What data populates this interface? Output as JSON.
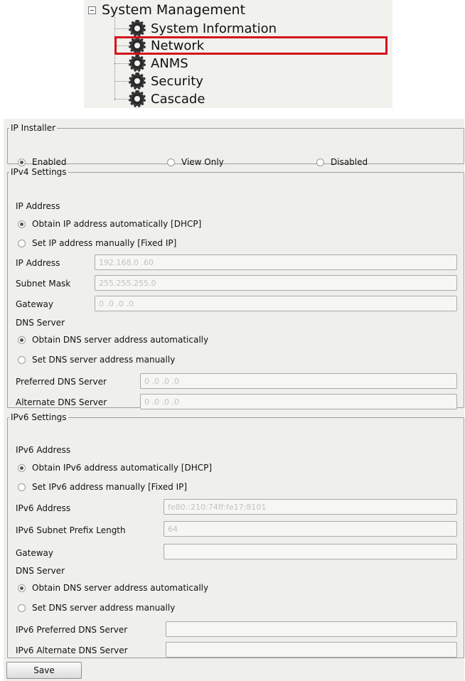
{
  "tree": {
    "root_label": "System Management",
    "items": [
      "System Information",
      "Network",
      "ANMS",
      "Security",
      "Cascade"
    ],
    "selected": "Network",
    "highlight_color": "#d3131b"
  },
  "ip_installer": {
    "title": "IP Installer",
    "options": [
      {
        "label": "Enabled",
        "selected": true
      },
      {
        "label": "View Only",
        "selected": false
      },
      {
        "label": "Disabled",
        "selected": false
      }
    ]
  },
  "ipv4": {
    "title": "IPv4 Settings",
    "ip_address_heading": "IP Address",
    "ip_mode_options": [
      {
        "label": "Obtain IP address automatically [DHCP]",
        "selected": true
      },
      {
        "label": "Set IP address manually [Fixed IP]",
        "selected": false
      }
    ],
    "ip_address": {
      "label": "IP Address",
      "value": "192.168.0 .60"
    },
    "subnet_mask": {
      "label": "Subnet Mask",
      "value": "255.255.255.0"
    },
    "gateway": {
      "label": "Gateway",
      "value": "0 .0 .0 .0"
    },
    "dns_heading": "DNS Server",
    "dns_mode_options": [
      {
        "label": "Obtain DNS server address automatically",
        "selected": true
      },
      {
        "label": "Set DNS server address manually",
        "selected": false
      }
    ],
    "preferred_dns": {
      "label": "Preferred DNS Server",
      "value": "0 .0 .0 .0"
    },
    "alternate_dns": {
      "label": "Alternate DNS Server",
      "value": "0 .0 .0 .0"
    }
  },
  "ipv6": {
    "title": "IPv6 Settings",
    "address_heading": "IPv6 Address",
    "ip_mode_options": [
      {
        "label": "Obtain IPv6 address automatically [DHCP]",
        "selected": true
      },
      {
        "label": "Set IPv6 address manually [Fixed IP]",
        "selected": false
      }
    ],
    "ipv6_address": {
      "label": "IPv6 Address",
      "value": "fe80::210:74ff:fe17:8101"
    },
    "prefix_length": {
      "label": "IPv6 Subnet Prefix Length",
      "value": "64"
    },
    "gateway": {
      "label": "Gateway",
      "value": ""
    },
    "dns_heading": "DNS Server",
    "dns_mode_options": [
      {
        "label": "Obtain DNS server address automatically",
        "selected": true
      },
      {
        "label": "Set DNS server address manually",
        "selected": false
      }
    ],
    "preferred_dns": {
      "label": "IPv6 Preferred DNS Server",
      "value": ""
    },
    "alternate_dns": {
      "label": "IPv6 Alternate DNS Server",
      "value": ""
    }
  },
  "save_label": "Save"
}
